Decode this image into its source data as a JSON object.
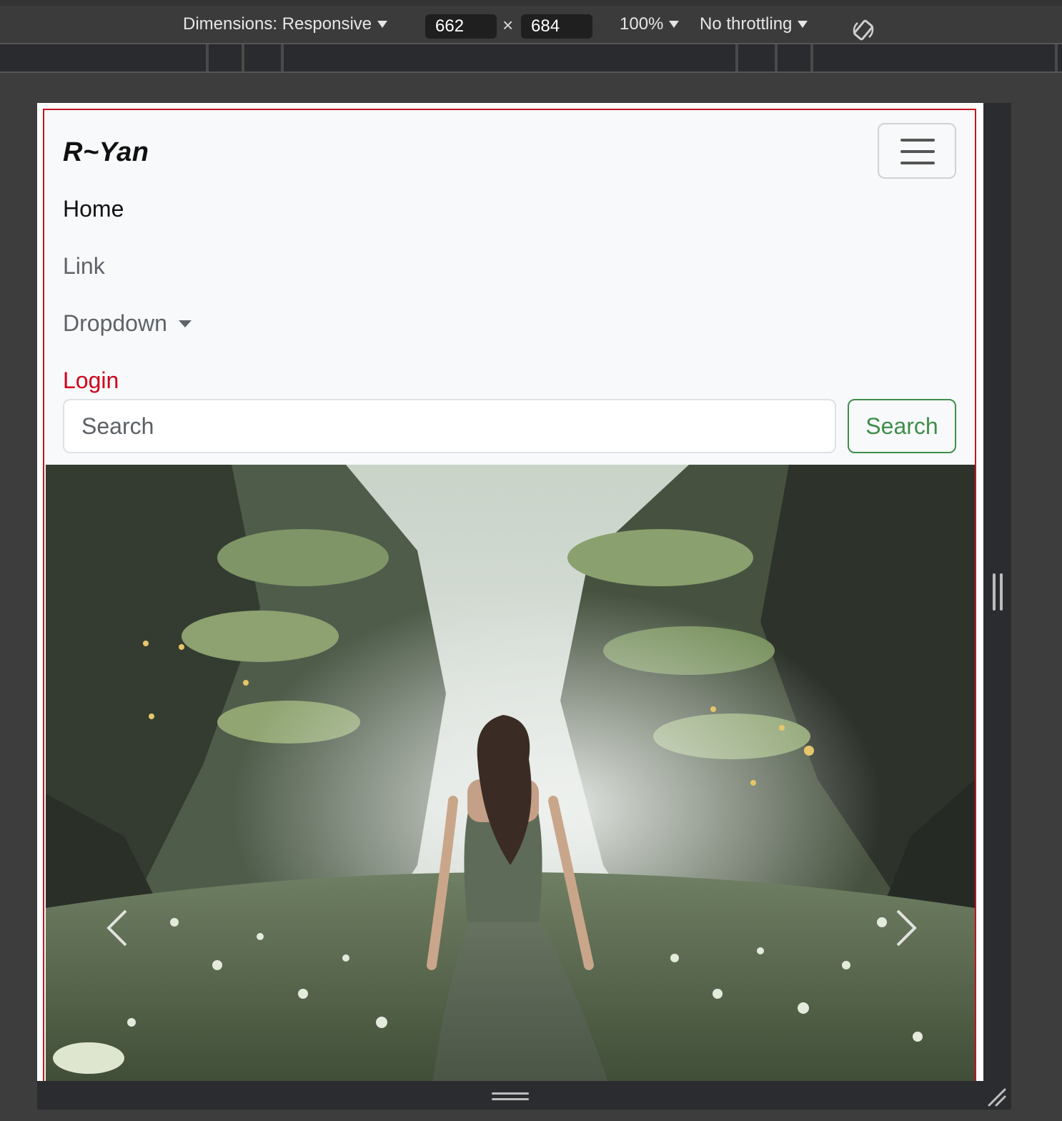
{
  "devtools": {
    "dimensions_label": "Dimensions: Responsive",
    "width_value": "662",
    "height_value": "684",
    "times_symbol": "×",
    "zoom_label": "100%",
    "throttling_label": "No throttling"
  },
  "navbar": {
    "brand": "R~Yan",
    "items": [
      {
        "label": "Home"
      },
      {
        "label": "Link"
      },
      {
        "label": "Dropdown"
      },
      {
        "label": "Login"
      }
    ],
    "search_placeholder": "Search",
    "search_button": "Search"
  },
  "colors": {
    "login": "#d0021b",
    "search_button": "#3e8e4a",
    "frame_border": "#c0161d"
  }
}
